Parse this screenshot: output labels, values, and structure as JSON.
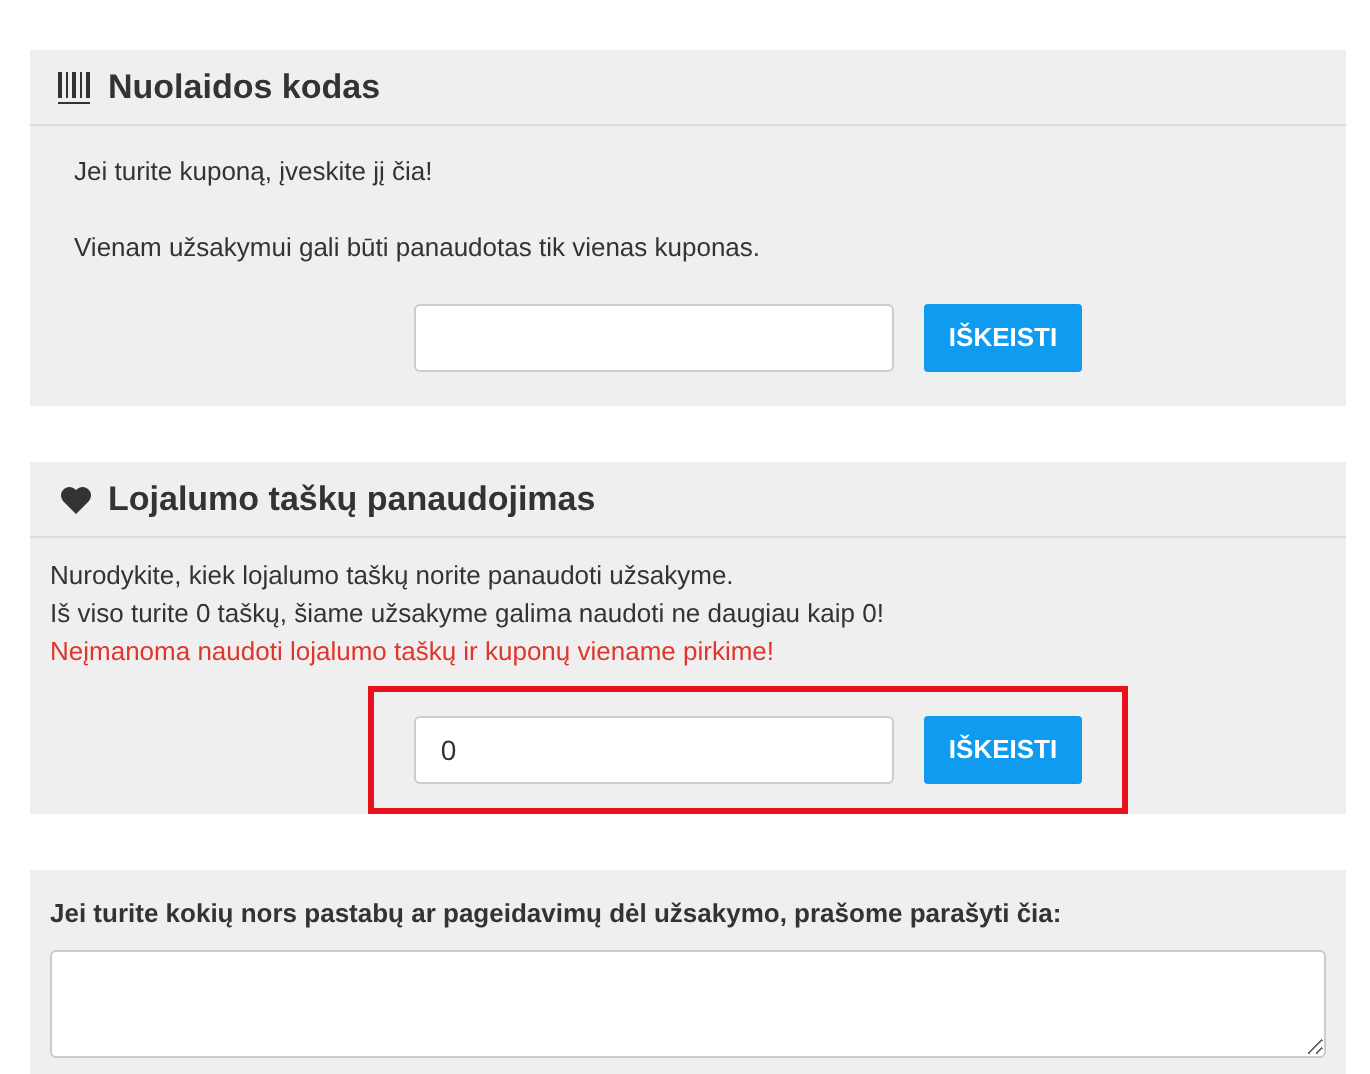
{
  "coupon_panel": {
    "title": "Nuolaidos kodas",
    "lines": [
      "Jei turite kuponą, įveskite jį čia!",
      "Vienam užsakymui gali būti panaudotas tik vienas kuponas."
    ],
    "button": "IŠKEISTI"
  },
  "loyalty_panel": {
    "title": "Lojalumo taškų panaudojimas",
    "lines": [
      {
        "text": "Nurodykite, kiek lojalumo taškų norite panaudoti užsakyme.",
        "kind": "info"
      },
      {
        "text": "Iš viso turite 0 taškų, šiame užsakyme galima naudoti ne daugiau kaip 0!",
        "kind": "info"
      },
      {
        "text": "Neįmanoma naudoti lojalumo taškų ir kuponų viename pirkime!",
        "kind": "warning"
      }
    ],
    "field": {
      "value": "0"
    },
    "button": "IŠKEISTI",
    "highlighted": true
  },
  "notes_panel": {
    "label": "Jei turite kokių nors pastabų ar pageidavimų dėl užsakymo, prašome parašyti čia:"
  }
}
